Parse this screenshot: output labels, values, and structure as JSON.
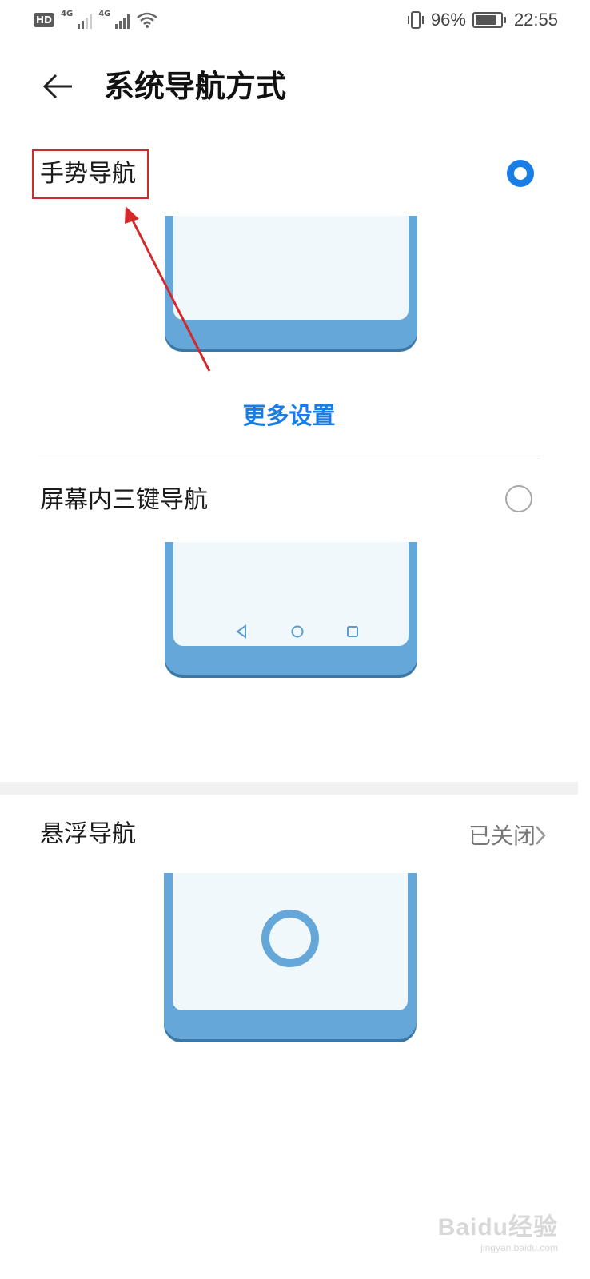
{
  "status_bar": {
    "hd_label": "HD",
    "net1": "4G",
    "net2": "4G",
    "battery_percent_text": "96%",
    "battery_level": 0.96,
    "time": "22:55"
  },
  "header": {
    "title": "系统导航方式"
  },
  "options": [
    {
      "label": "手势导航",
      "selected": true
    },
    {
      "label": "屏幕内三键导航",
      "selected": false
    }
  ],
  "gesture": {
    "more_settings_label": "更多设置"
  },
  "floating_nav": {
    "label": "悬浮导航",
    "status": "已关闭"
  },
  "watermark": {
    "brand": "Baidu经验",
    "site": "jingyan.baidu.com"
  },
  "colors": {
    "accent": "#1a7ce5",
    "annotation": "#d22a2a",
    "phone_body": "#64a7d8",
    "phone_screen": "#f1f8fc"
  },
  "icons": {
    "back": "arrow-left-icon",
    "chevron": "chevron-right-icon",
    "vibrate": "vibrate-icon",
    "wifi": "wifi-icon"
  }
}
